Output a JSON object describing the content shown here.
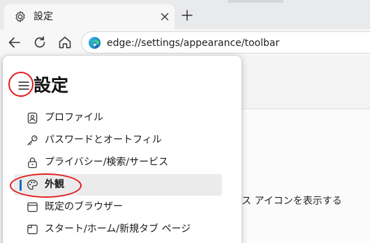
{
  "tab": {
    "title": "設定",
    "icon": "gear-icon",
    "close_icon": "close-icon",
    "new_tab_icon": "plus-icon"
  },
  "toolbar": {
    "back_icon": "back-arrow-icon",
    "refresh_icon": "refresh-icon",
    "home_icon": "home-icon",
    "url": "edge://settings/appearance/toolbar",
    "site_icon": "edge-logo-icon"
  },
  "settings": {
    "title": "設定",
    "menu_icon": "hamburger-menu-icon",
    "nav_items": [
      {
        "label": "プロファイル",
        "icon": "profile-icon",
        "active": false
      },
      {
        "label": "パスワードとオートフィル",
        "icon": "key-icon",
        "active": false
      },
      {
        "label": "プライバシー/検索/サービス",
        "icon": "lock-icon",
        "active": false
      },
      {
        "label": "外観",
        "icon": "palette-icon",
        "active": true
      },
      {
        "label": "既定のブラウザー",
        "icon": "browser-window-icon",
        "active": false
      },
      {
        "label": "スタート/ホーム/新規タブ ページ",
        "icon": "start-page-icon",
        "active": false
      }
    ]
  },
  "background_page": {
    "partial_text": "ス アイコンを表示する"
  },
  "colors": {
    "accent": "#0f6cbd",
    "annotation": "#e31b1b",
    "active_item_bg": "#ebebeb"
  }
}
